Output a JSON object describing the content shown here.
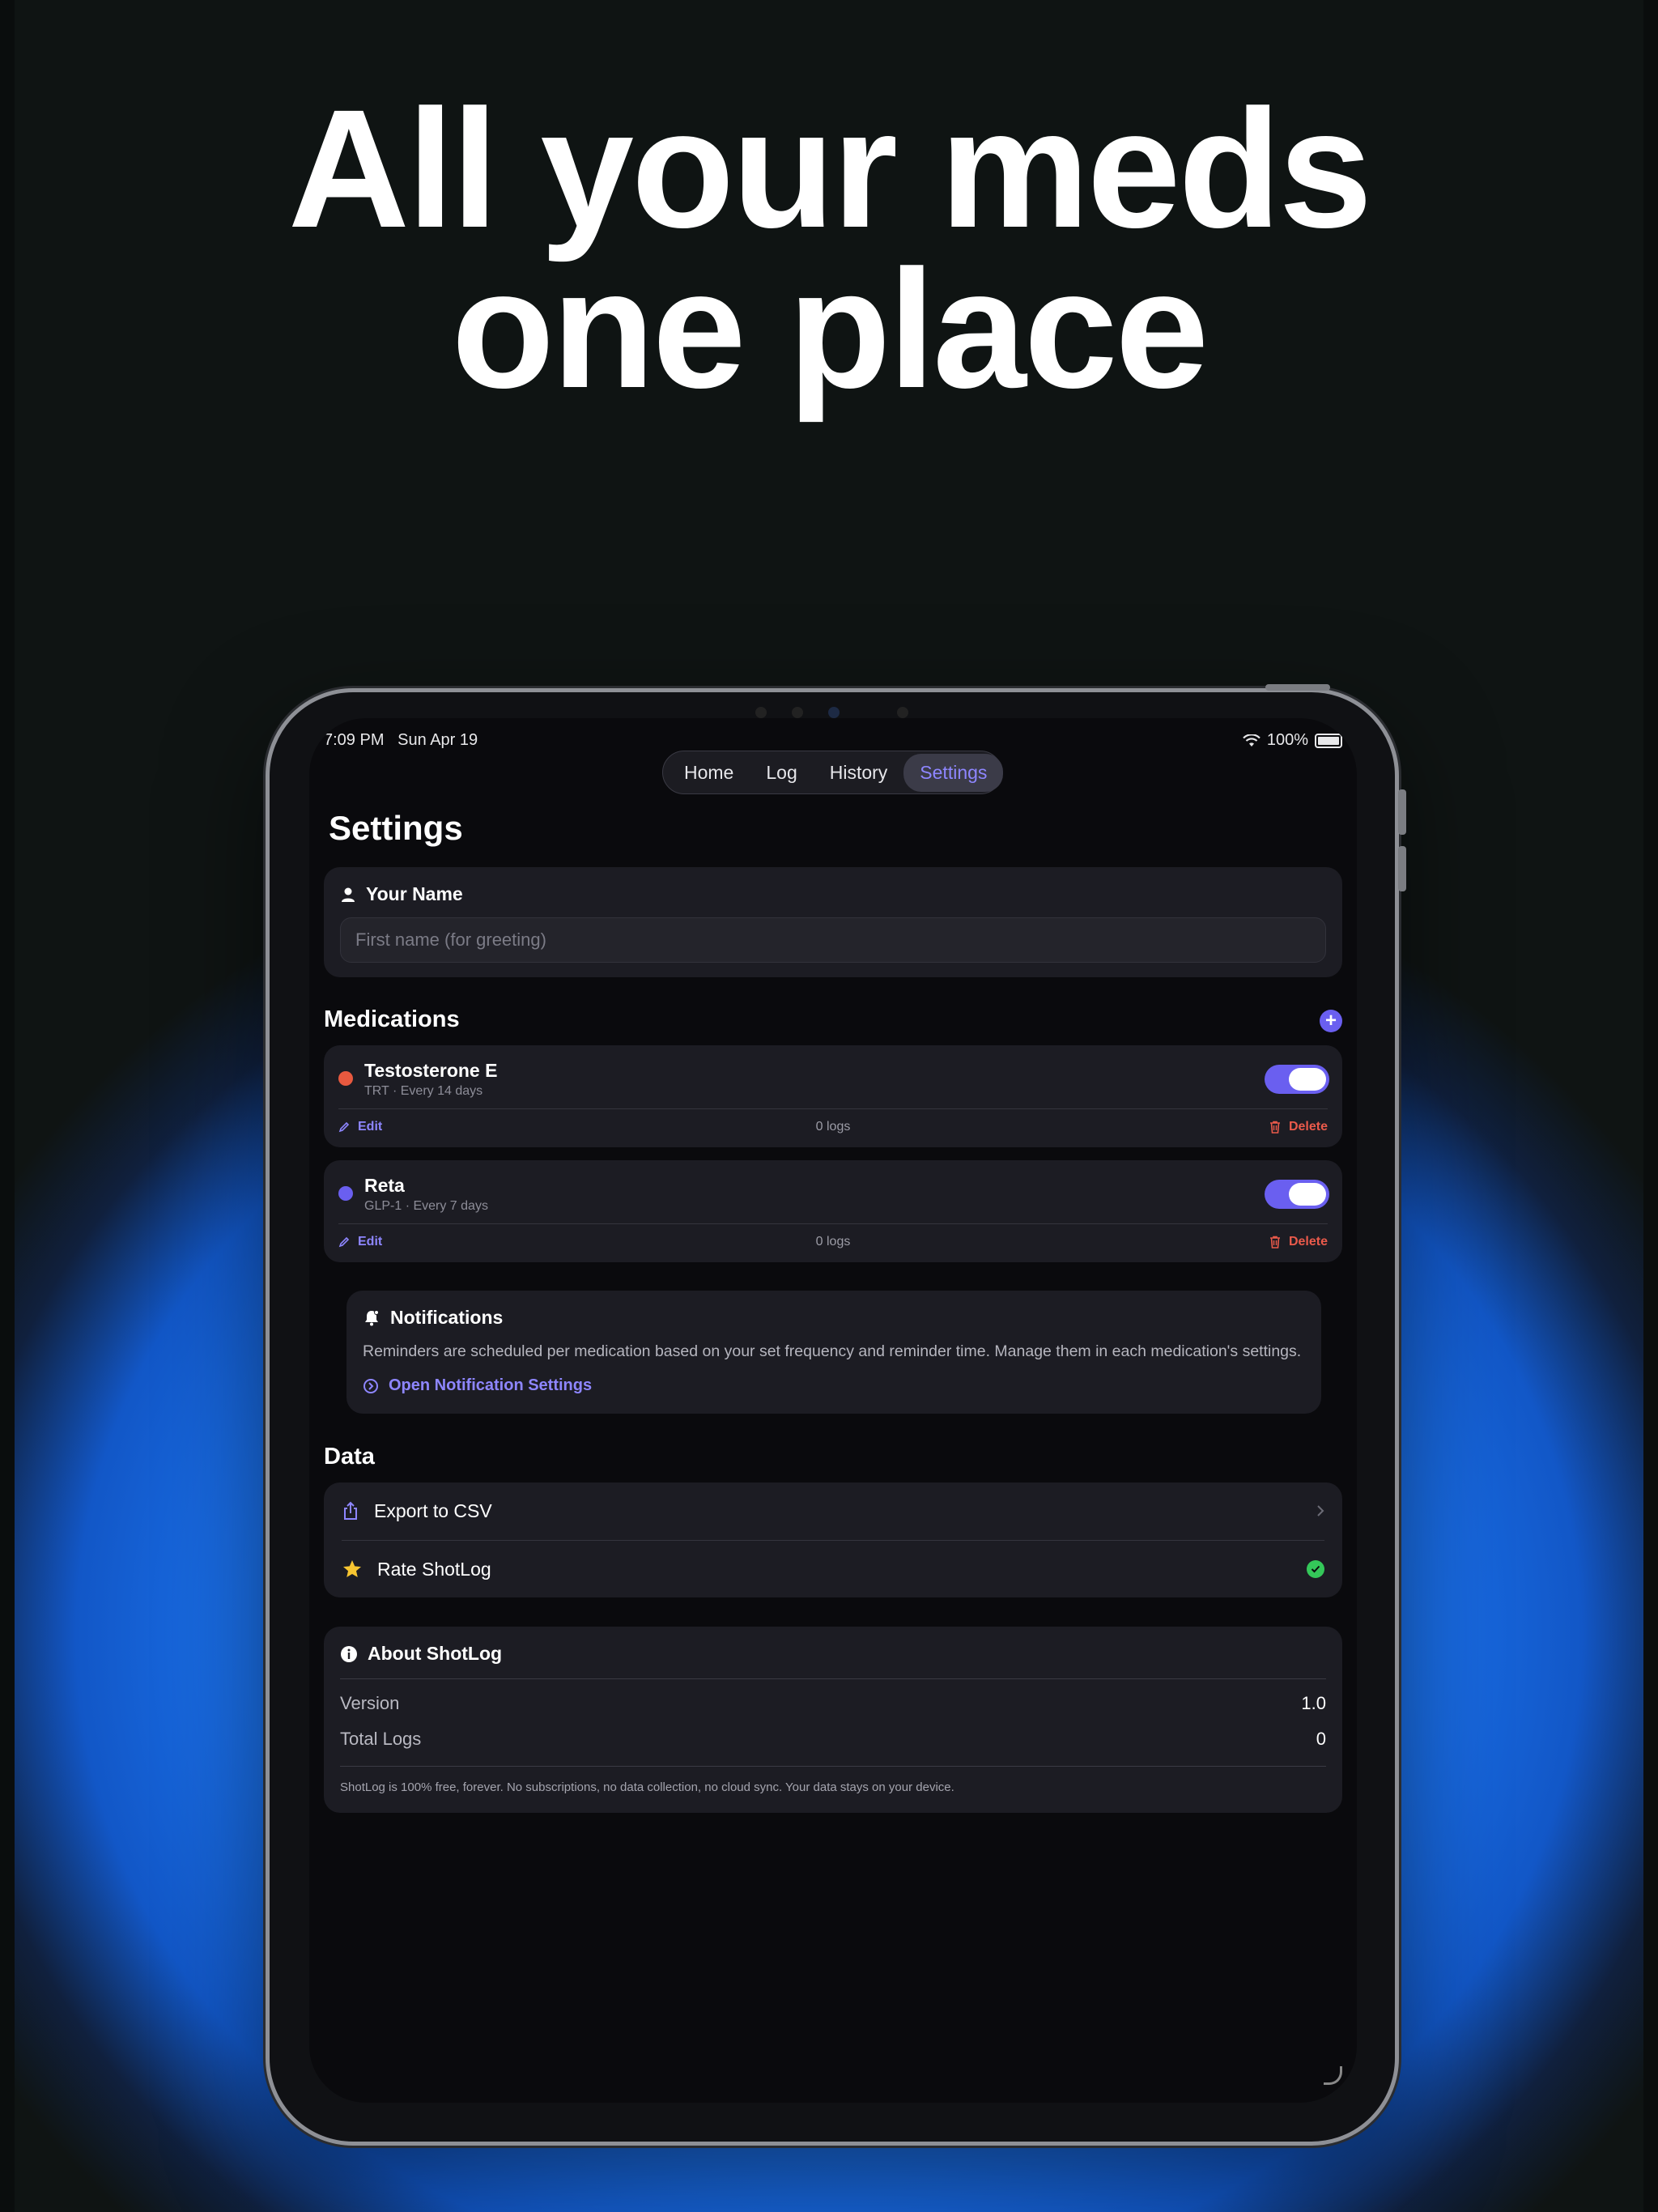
{
  "headline": {
    "line1": "All your meds",
    "line2": "one place"
  },
  "status_bar": {
    "time": "7:09 PM",
    "date": "Sun Apr 19",
    "battery": "100%"
  },
  "tabs": [
    {
      "label": "Home",
      "active": false
    },
    {
      "label": "Log",
      "active": false
    },
    {
      "label": "History",
      "active": false
    },
    {
      "label": "Settings",
      "active": true
    }
  ],
  "page_title": "Settings",
  "name_section": {
    "title": "Your Name",
    "placeholder": "First name (for greeting)"
  },
  "medications": {
    "title": "Medications",
    "items": [
      {
        "name": "Testosterone E",
        "subtitle": "TRT · Every 14 days",
        "dot_color": "#e8593f",
        "enabled": true,
        "edit_label": "Edit",
        "logs": "0 logs",
        "delete_label": "Delete"
      },
      {
        "name": "Reta",
        "subtitle": "GLP-1 · Every 7 days",
        "dot_color": "#6a5ff0",
        "enabled": true,
        "edit_label": "Edit",
        "logs": "0 logs",
        "delete_label": "Delete"
      }
    ]
  },
  "notifications": {
    "title": "Notifications",
    "body": "Reminders are scheduled per medication based on your set frequency and reminder time. Manage them in each medication's settings.",
    "link": "Open Notification Settings"
  },
  "data_section": {
    "title": "Data",
    "rows": [
      {
        "label": "Export to CSV",
        "icon": "share-icon",
        "trailing": "chevron-right-icon"
      },
      {
        "label": "Rate ShotLog",
        "icon": "star-icon",
        "trailing": "checkmark-icon"
      }
    ]
  },
  "about": {
    "title": "About ShotLog",
    "version_label": "Version",
    "version_value": "1.0",
    "total_logs_label": "Total Logs",
    "total_logs_value": "0",
    "footer": "ShotLog is 100% free, forever. No subscriptions, no data collection, no cloud sync. Your data stays on your device."
  },
  "colors": {
    "accent": "#6a5ff0",
    "accent_text": "#8e86ff",
    "delete": "#ea5a4b",
    "success": "#34c759",
    "background_blue": "#1a6fe8"
  }
}
